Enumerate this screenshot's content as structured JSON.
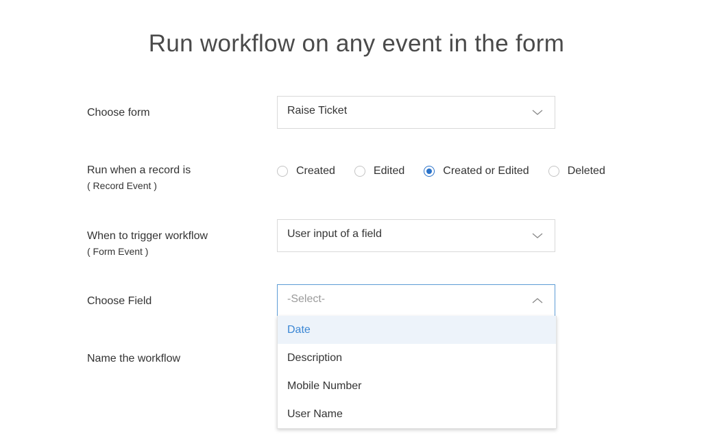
{
  "title": "Run workflow on any event in the form",
  "form_select": {
    "label": "Choose form",
    "value": "Raise Ticket"
  },
  "record_event": {
    "label": "Run when a record is",
    "sublabel": "( Record Event )",
    "options": [
      {
        "label": "Created",
        "checked": false
      },
      {
        "label": "Edited",
        "checked": false
      },
      {
        "label": "Created or Edited",
        "checked": true
      },
      {
        "label": "Deleted",
        "checked": false
      }
    ]
  },
  "form_event": {
    "label": "When to trigger workflow",
    "sublabel": "( Form Event )",
    "value": "User input of a field"
  },
  "field_select": {
    "label": "Choose Field",
    "placeholder": "-Select-",
    "open": true,
    "options": [
      "Date",
      "Description",
      "Mobile Number",
      "User Name"
    ],
    "highlighted": "Date"
  },
  "workflow_name": {
    "label": "Name the workflow"
  },
  "colors": {
    "accent": "#2a72c9",
    "highlight_bg": "#edf3fa",
    "highlight_text": "#3a86d4"
  },
  "icons": {
    "collapsed": "chevron-down-icon",
    "expanded": "chevron-up-icon"
  }
}
